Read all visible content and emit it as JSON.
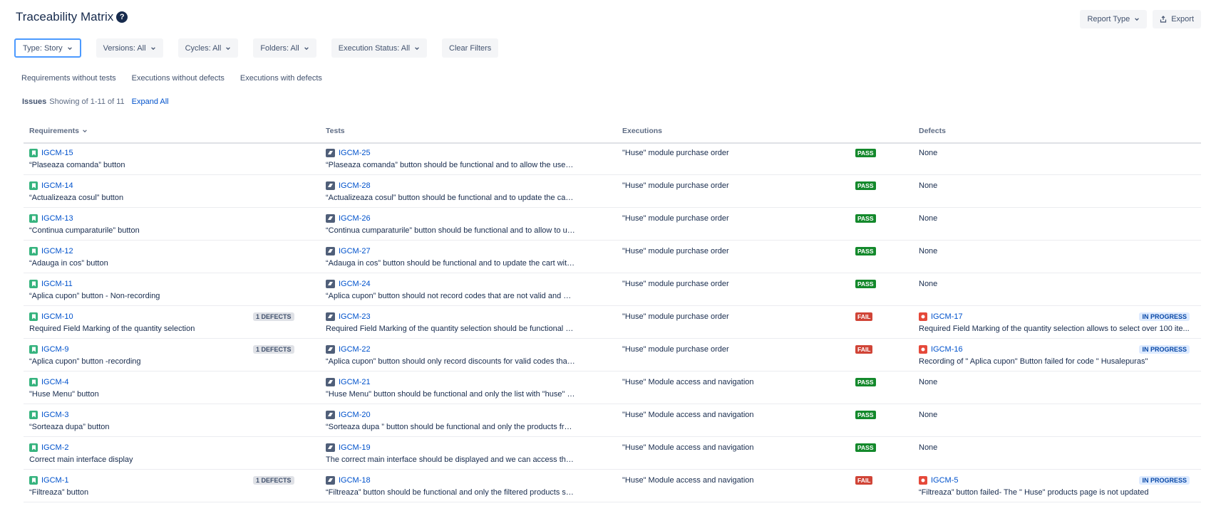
{
  "header": {
    "title": "Traceability Matrix",
    "help_glyph": "?",
    "report_type_label": "Report Type",
    "export_label": "Export"
  },
  "filters": [
    {
      "label": "Type: Story"
    },
    {
      "label": "Versions: All"
    },
    {
      "label": "Cycles: All"
    },
    {
      "label": "Folders: All"
    },
    {
      "label": "Execution Status: All"
    }
  ],
  "clear_filters_label": "Clear Filters",
  "quick_tabs": [
    "Requirements without tests",
    "Executions without defects",
    "Executions with defects"
  ],
  "issues": {
    "label": "Issues",
    "count_text": "Showing of 1-11 of 11",
    "expand_all": "Expand All"
  },
  "columns": {
    "requirements": "Requirements",
    "tests": "Tests",
    "executions": "Executions",
    "defects": "Defects"
  },
  "colors": {
    "pass": "#14892c",
    "fail": "#d04437",
    "link": "#0052cc",
    "story": "#36b37e",
    "bug": "#e5493a"
  },
  "rows": [
    {
      "req_key": "IGCM-15",
      "req_desc": "“Plaseaza comanda” button",
      "defects_badge": "",
      "test_key": "IGCM-25",
      "test_desc": "“Plaseaza comanda” button should be functional and to allow the user to pl...",
      "exec": "\"Huse\" module purchase order",
      "status": "PASS",
      "defect_key": "",
      "defect_desc": "None",
      "defect_status": ""
    },
    {
      "req_key": "IGCM-14",
      "req_desc": "“Actualizeaza cosul” button",
      "defects_badge": "",
      "test_key": "IGCM-28",
      "test_desc": "“Actualizeaza cosul” button should be functional and to update the cart wit...",
      "exec": "\"Huse\" module purchase order",
      "status": "PASS",
      "defect_key": "",
      "defect_desc": "None",
      "defect_status": ""
    },
    {
      "req_key": "IGCM-13",
      "req_desc": "“Continua cumparaturile” button",
      "defects_badge": "",
      "test_key": "IGCM-26",
      "test_desc": "“Continua cumparaturile” button should be functional and to allow to user to ...",
      "exec": "\"Huse\" module purchase order",
      "status": "PASS",
      "defect_key": "",
      "defect_desc": "None",
      "defect_status": ""
    },
    {
      "req_key": "IGCM-12",
      "req_desc": "“Adauga in cos” button",
      "defects_badge": "",
      "test_key": "IGCM-27",
      "test_desc": "“Adauga in cos” button should be functional and to update the cart with the ...",
      "exec": "\"Huse\" module purchase order",
      "status": "PASS",
      "defect_key": "",
      "defect_desc": "None",
      "defect_status": ""
    },
    {
      "req_key": "IGCM-11",
      "req_desc": "“Aplica cupon” button - Non-recording",
      "defects_badge": "",
      "test_key": "IGCM-24",
      "test_desc": "“Aplica cupon” button should not record codes that are not valid and are ap...",
      "exec": "\"Huse\" module purchase order",
      "status": "PASS",
      "defect_key": "",
      "defect_desc": "None",
      "defect_status": ""
    },
    {
      "req_key": "IGCM-10",
      "req_desc": "Required Field Marking of the quantity selection",
      "defects_badge": "1 DEFECTS",
      "test_key": "IGCM-23",
      "test_desc": "Required Field Marking of the quantity selection should be functional and the...",
      "exec": "\"Huse\" module purchase order",
      "status": "FAIL",
      "defect_key": "IGCM-17",
      "defect_desc": "Required Field Marking of the quantity selection allows to select over 100 ite...",
      "defect_status": "IN PROGRESS"
    },
    {
      "req_key": "IGCM-9",
      "req_desc": "“Aplica cupon” button -recording",
      "defects_badge": "1 DEFECTS",
      "test_key": "IGCM-22",
      "test_desc": "“Aplica cupon” button should only record discounts for valid codes that are ...",
      "exec": "\"Huse\" module purchase order",
      "status": "FAIL",
      "defect_key": "IGCM-16",
      "defect_desc": "Recording of \" Aplica cupon\" Button failed for code \" Husalepuras\"",
      "defect_status": "IN PROGRESS"
    },
    {
      "req_key": "IGCM-4",
      "req_desc": "\"Huse Menu\" button",
      "defects_badge": "",
      "test_key": "IGCM-21",
      "test_desc": "\"Huse Menu\" button should be functional and only the list with \"huse\" produ...",
      "exec": "\"Huse\" Module access and navigation",
      "status": "PASS",
      "defect_key": "",
      "defect_desc": "None",
      "defect_status": ""
    },
    {
      "req_key": "IGCM-3",
      "req_desc": "“Sorteaza dupa” button",
      "defects_badge": "",
      "test_key": "IGCM-20",
      "test_desc": "“Sorteaza dupa ” button should be functional and only the products from th...",
      "exec": "\"Huse\" Module access and navigation",
      "status": "PASS",
      "defect_key": "",
      "defect_desc": "None",
      "defect_status": ""
    },
    {
      "req_key": "IGCM-2",
      "req_desc": "Correct main interface display",
      "defects_badge": "",
      "test_key": "IGCM-19",
      "test_desc": "The correct main interface should be displayed and we can access the mai...",
      "exec": "\"Huse\" Module access and navigation",
      "status": "PASS",
      "defect_key": "",
      "defect_desc": "None",
      "defect_status": ""
    },
    {
      "req_key": "IGCM-1",
      "req_desc": "“Filtreaza” button",
      "defects_badge": "1 DEFECTS",
      "test_key": "IGCM-18",
      "test_desc": "“Filtreaza” button should be functional and only the filtered products should ...",
      "exec": "\"Huse\" Module access and navigation",
      "status": "FAIL",
      "defect_key": "IGCM-5",
      "defect_desc": "“Filtreaza” button failed- The \" Huse\" products page is not updated",
      "defect_status": "IN PROGRESS"
    }
  ]
}
